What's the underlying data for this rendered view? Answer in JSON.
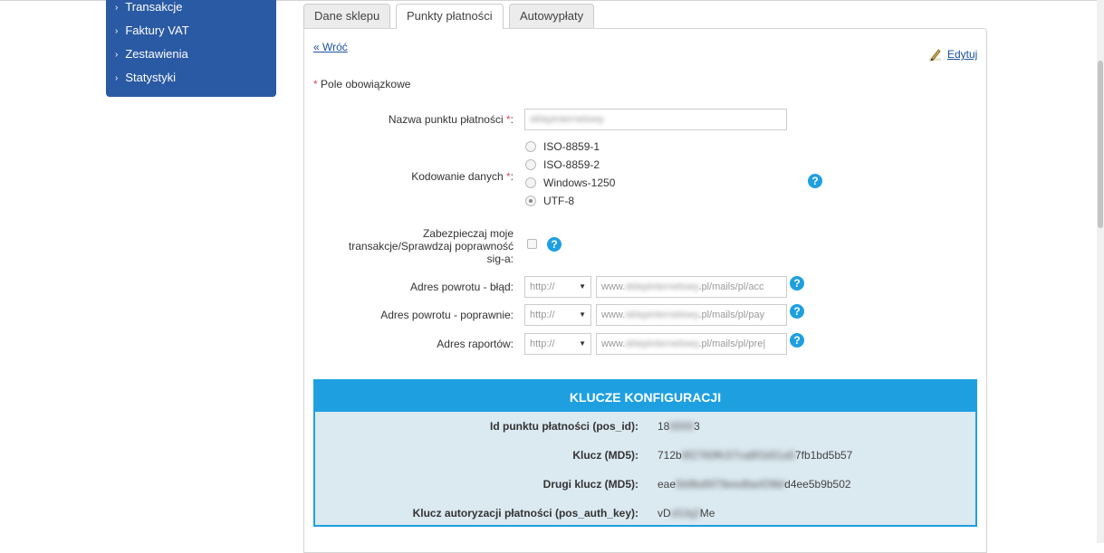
{
  "sidebar": {
    "items": [
      {
        "label": "Transakcje"
      },
      {
        "label": "Faktury VAT"
      },
      {
        "label": "Zestawienia"
      },
      {
        "label": "Statystyki"
      }
    ]
  },
  "tabs": [
    {
      "label": "Dane sklepu"
    },
    {
      "label": "Punkty płatności"
    },
    {
      "label": "Autowypłaty"
    }
  ],
  "actions": {
    "back": "« Wróć",
    "edit": "Edytuj"
  },
  "required_note": "Pole obowiązkowe",
  "required_mark": "*",
  "form": {
    "name_label": "Nazwa punktu płatności",
    "name_value": "sklepinternetowy",
    "encoding_label": "Kodowanie danych",
    "encoding_options": [
      "ISO-8859-1",
      "ISO-8859-2",
      "Windows-1250",
      "UTF-8"
    ],
    "encoding_selected": "UTF-8",
    "secure_label_1": "Zabezpieczaj moje",
    "secure_label_2": "transakcje/Sprawdzaj poprawność",
    "secure_label_3": "sig-a:",
    "secure_checked": false,
    "url_fields": [
      {
        "label": "Adres powrotu - błąd:",
        "protocol": "http://",
        "prefix": "www.",
        "hidden": "sklepinternetowy",
        "suffix": ".pl/mails/pl/acc"
      },
      {
        "label": "Adres powrotu - poprawnie:",
        "protocol": "http://",
        "prefix": "www.",
        "hidden": "sklepinternetowy",
        "suffix": ".pl/mails/pl/pay"
      },
      {
        "label": "Adres raportów:",
        "protocol": "http://",
        "prefix": "www.",
        "hidden": "sklepinternetowy",
        "suffix": ".pl/mails/pl/pre|"
      }
    ],
    "help_glyph": "?"
  },
  "keys": {
    "title": "KLUCZE KONFIGURACJI",
    "rows": [
      {
        "label": "Id punktu płatności (pos_id):",
        "visible_start": "18",
        "hidden": "0000",
        "visible_end": "3"
      },
      {
        "label": "Klucz (MD5):",
        "visible_start": "712b",
        "hidden": "9f2760ffc57ca8f1b51a5",
        "visible_end": "7fb1bd5b57"
      },
      {
        "label": "Drugi klucz (MD5):",
        "visible_start": "eae",
        "hidden": "5b9bd5f78eedfaef29bf",
        "visible_end": "d4ee5b9b502"
      },
      {
        "label": "Klucz autoryzacji płatności (pos_auth_key):",
        "visible_start": "vD",
        "hidden": "x0Jq2",
        "visible_end": "Me"
      }
    ]
  },
  "colors": {
    "sidebar_bg": "#2a5aa3",
    "accent": "#1ea0e0",
    "keys_bg": "#dbe9f1",
    "required": "#d9534f",
    "link": "#1a52a0"
  }
}
